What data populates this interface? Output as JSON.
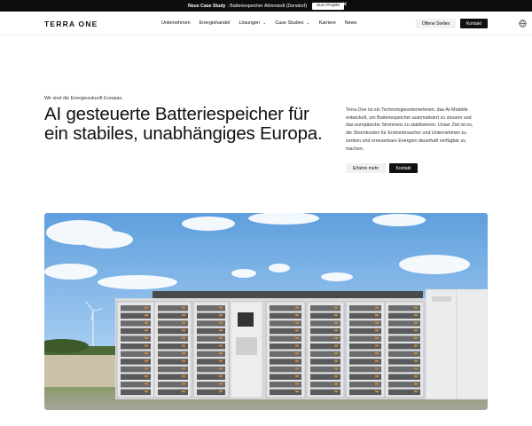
{
  "announcement": {
    "label_strong": "Neue Case Study",
    "label_text": ": Batteriespeicher Ahlerstedt (Dersdorf)",
    "button": "Zum Projekt",
    "close_icon": "close-icon"
  },
  "nav": {
    "logo": "TERRA ONE",
    "items": [
      {
        "label": "Unternehmen",
        "has_dropdown": false
      },
      {
        "label": "Energiehandel",
        "has_dropdown": false
      },
      {
        "label": "Lösungen",
        "has_dropdown": true
      },
      {
        "label": "Case Studies",
        "has_dropdown": true
      },
      {
        "label": "Karriere",
        "has_dropdown": false
      },
      {
        "label": "News",
        "has_dropdown": false
      }
    ],
    "cta_ghost": "Offene Stellen",
    "cta_solid": "Kontakt",
    "language_icon": "globe-icon"
  },
  "hero": {
    "eyebrow": "Wir sind die Energiezukunft Europas.",
    "headline": "AI gesteuerte Batteriespeicher für ein stabiles, unabhängiges Europa.",
    "description": "Terra One ist ein Technologieunternehmen, das AI-Modelle entwickelt, um Batteriespeicher automatisiert zu steuern und das europäische Stromnetz zu stabilisieren. Unser Ziel ist es, die Stromkosten für Endverbraucher und Unternehmen zu senken und erneuerbare Energien dauerhaft verfügbar zu machen.",
    "button_more": "Erfahre mehr",
    "button_contact": "Kontakt"
  },
  "colors": {
    "dark": "#111111",
    "light_button": "#f1f1f1",
    "sky": "#7fb3e6"
  }
}
